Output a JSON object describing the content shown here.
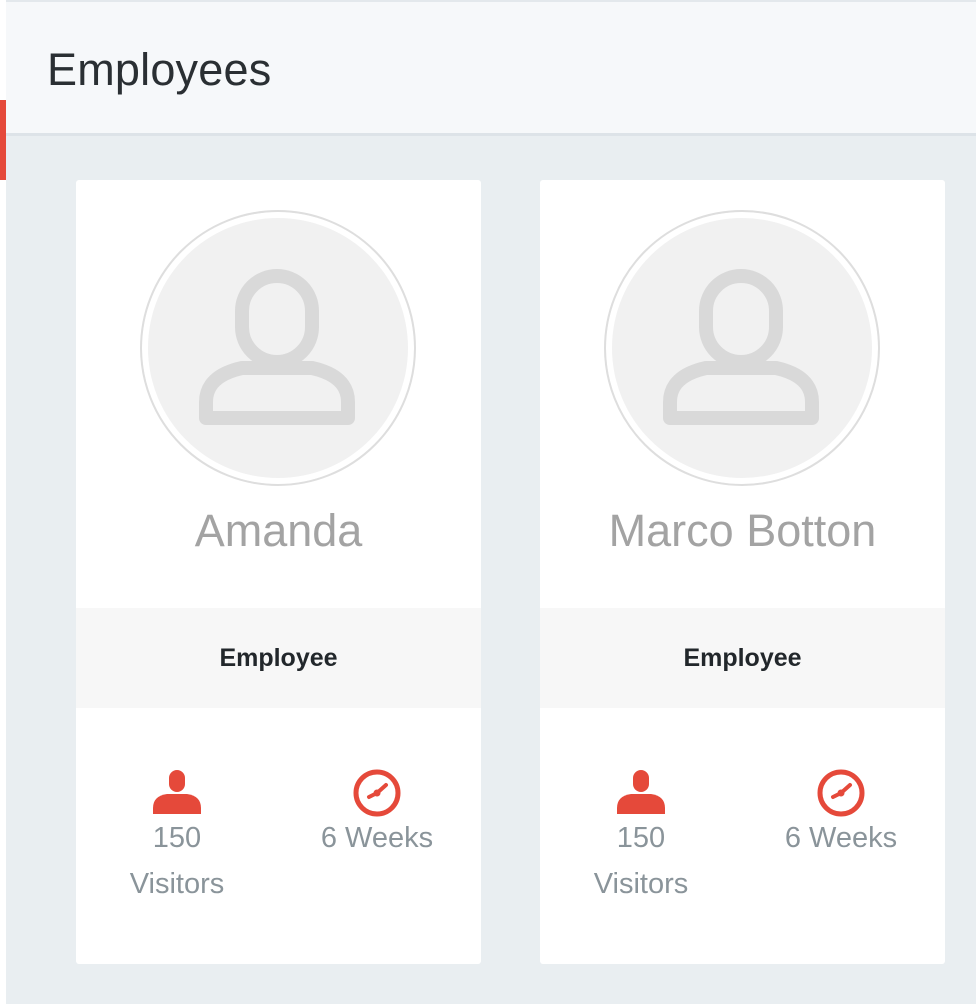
{
  "header": {
    "title": "Employees"
  },
  "colors": {
    "accent": "#e5493a",
    "name": "#a3a3a3",
    "stat": "#8a949a"
  },
  "employees": [
    {
      "name": "Amanda",
      "role": "Employee",
      "visitors": "150",
      "visitors_label": "Visitors",
      "duration": "6 Weeks",
      "avatar_icon": "user-placeholder-icon",
      "visitors_icon": "person-icon",
      "duration_icon": "clock-icon"
    },
    {
      "name": "Marco Botton",
      "role": "Employee",
      "visitors": "150",
      "visitors_label": "Visitors",
      "duration": "6 Weeks",
      "avatar_icon": "user-placeholder-icon",
      "visitors_icon": "person-icon",
      "duration_icon": "clock-icon"
    }
  ]
}
